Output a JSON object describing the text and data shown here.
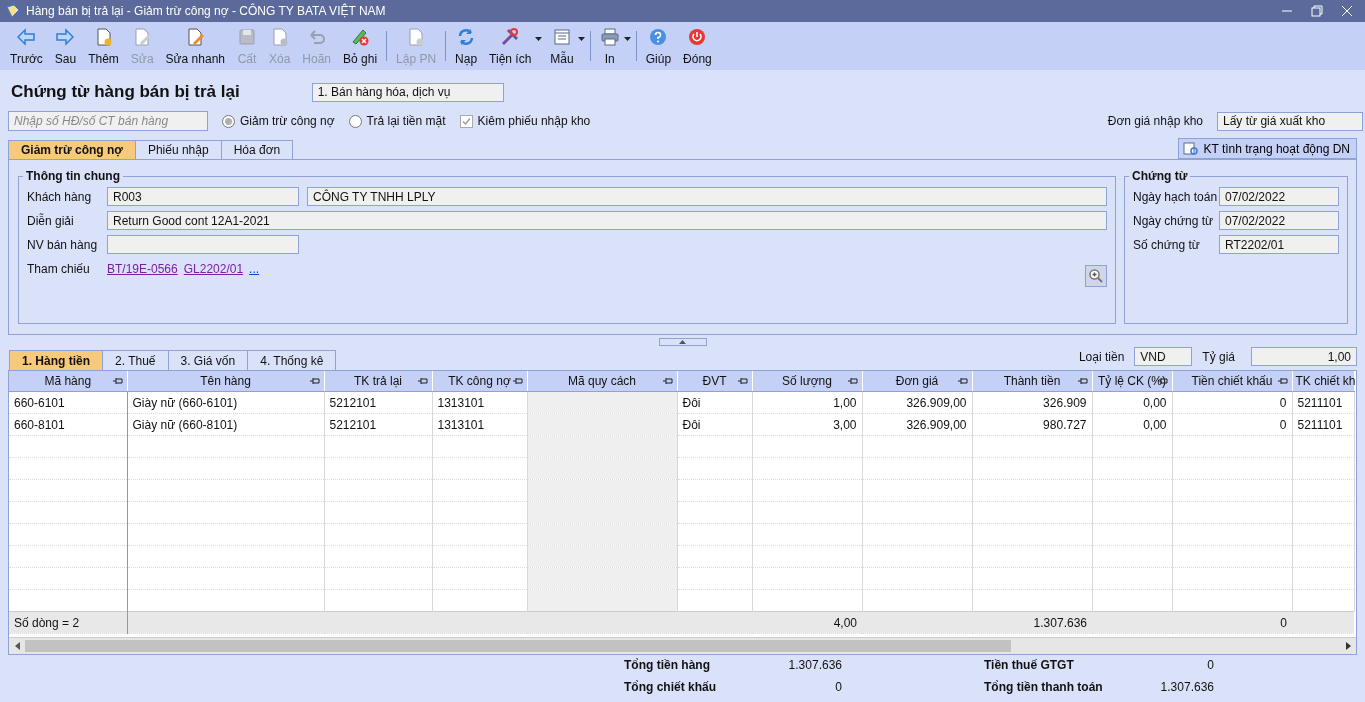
{
  "window": {
    "title": "Hàng bán bị trả lại - Giảm trừ công nợ - CÔNG TY BATA VIỆT NAM"
  },
  "toolbar": [
    [
      {
        "label": "Trước",
        "disabled": false,
        "dropdown": false
      },
      {
        "label": "Sau",
        "disabled": false,
        "dropdown": false
      },
      {
        "label": "Thêm",
        "disabled": false,
        "dropdown": false
      },
      {
        "label": "Sửa",
        "disabled": true,
        "dropdown": false
      },
      {
        "label": "Sửa nhanh",
        "disabled": false,
        "dropdown": false
      },
      {
        "label": "Cất",
        "disabled": true,
        "dropdown": false
      },
      {
        "label": "Xóa",
        "disabled": true,
        "dropdown": false
      },
      {
        "label": "Hoãn",
        "disabled": true,
        "dropdown": false
      },
      {
        "label": "Bỏ ghi",
        "disabled": false,
        "dropdown": false
      }
    ],
    [
      {
        "label": "Lập PN",
        "disabled": true,
        "dropdown": false
      }
    ],
    [
      {
        "label": "Nạp",
        "disabled": false,
        "dropdown": false
      },
      {
        "label": "Tiện ích",
        "disabled": false,
        "dropdown": true
      },
      {
        "label": "Mẫu",
        "disabled": false,
        "dropdown": true
      }
    ],
    [
      {
        "label": "In",
        "disabled": false,
        "dropdown": true
      }
    ],
    [
      {
        "label": "Giúp",
        "disabled": false,
        "dropdown": false
      },
      {
        "label": "Đóng",
        "disabled": false,
        "dropdown": false
      }
    ]
  ],
  "heading": "Chứng từ hàng bán bị trả lại",
  "voucher_type": "1. Bán hàng hóa, dịch vụ",
  "invoice_search": {
    "placeholder": "Nhập số HĐ/số CT bán hàng"
  },
  "options": [
    {
      "label": "Giảm trừ công nợ",
      "kind": "radio",
      "checked": true
    },
    {
      "label": "Trả lại tiền mặt",
      "kind": "radio",
      "checked": false
    },
    {
      "label": "Kiêm phiếu nhập kho",
      "kind": "checkbox",
      "checked": true
    }
  ],
  "unit_price_source": {
    "label": "Đơn giá nhập kho",
    "value": "Lấy từ giá xuất kho"
  },
  "tabs": [
    {
      "label": "Giảm trừ công nợ",
      "selected": true
    },
    {
      "label": "Phiếu nhập",
      "selected": false
    },
    {
      "label": "Hóa đơn",
      "selected": false
    }
  ],
  "check_button": "KT tình trạng hoạt động DN",
  "general": {
    "title": "Thông tin chung",
    "customer": {
      "label": "Khách hàng",
      "code": "R003",
      "name": "CÔNG TY TNHH LPLY"
    },
    "description": {
      "label": "Diễn giải",
      "value": "Return Good cont 12A1-2021"
    },
    "salesperson": {
      "label": "NV bán hàng"
    },
    "references": {
      "label": "Tham chiếu",
      "links": [
        "BT/19E-0566",
        "GL2202/01",
        "..."
      ]
    }
  },
  "voucher": {
    "title": "Chứng từ",
    "fields": [
      {
        "label": "Ngày hạch toán",
        "value": "07/02/2022"
      },
      {
        "label": "Ngày chứng từ",
        "value": "07/02/2022"
      },
      {
        "label": "Số chứng từ",
        "value": "RT2202/01"
      }
    ]
  },
  "detail_tabs": [
    {
      "label": "1. Hàng tiền",
      "selected": true
    },
    {
      "label": "2. Thuế",
      "selected": false
    },
    {
      "label": "3. Giá vốn",
      "selected": false
    },
    {
      "label": "4. Thống kê",
      "selected": false
    }
  ],
  "currency": {
    "label": "Loại tiền",
    "value": "VND"
  },
  "rate": {
    "label": "Tỷ giá",
    "value": "1,00"
  },
  "table": {
    "columns": [
      {
        "label": "Mã hàng",
        "kind": "text",
        "disabled": false
      },
      {
        "label": "Tên hàng",
        "kind": "text",
        "disabled": false
      },
      {
        "label": "TK trả lại",
        "kind": "text",
        "disabled": false
      },
      {
        "label": "TK công nợ",
        "kind": "text",
        "disabled": false
      },
      {
        "label": "Mã quy cách",
        "kind": "text",
        "disabled": true
      },
      {
        "label": "ĐVT",
        "kind": "text",
        "disabled": false
      },
      {
        "label": "Số lượng",
        "kind": "number",
        "disabled": false
      },
      {
        "label": "Đơn giá",
        "kind": "number",
        "disabled": false
      },
      {
        "label": "Thành tiền",
        "kind": "number",
        "disabled": false
      },
      {
        "label": "Tỷ lệ CK (%)",
        "kind": "number",
        "disabled": false
      },
      {
        "label": "Tiền chiết khấu",
        "kind": "number",
        "disabled": false
      },
      {
        "label": "TK chiết kh",
        "kind": "text",
        "disabled": false
      }
    ],
    "rows": [
      {
        "code": "660-6101",
        "name": "Giày nữ (660-6101)",
        "return_account": "5212101",
        "receivable_account": "1313101",
        "unit": "Đôi",
        "quantity": "1,00",
        "unit_price": "326.909,00",
        "amount": "326.909",
        "discount_rate": "0,00",
        "discount_amount": "0",
        "discount_account": "5211101"
      },
      {
        "code": "660-8101",
        "name": "Giày nữ (660-8101)",
        "return_account": "5212101",
        "receivable_account": "1313101",
        "unit": "Đôi",
        "quantity": "3,00",
        "unit_price": "326.909,00",
        "amount": "980.727",
        "discount_rate": "0,00",
        "discount_amount": "0",
        "discount_account": "5211101"
      }
    ],
    "footer": {
      "row_count": "Số dòng = 2",
      "quantity": "4,00",
      "amount": "1.307.636",
      "discount_amount": "0"
    }
  },
  "summary": [
    {
      "label": "Tổng tiền hàng",
      "value": "1.307.636"
    },
    {
      "label": "Tiền thuế GTGT",
      "value": "0"
    },
    {
      "label": "Tổng chiết khấu",
      "value": "0"
    },
    {
      "label": "Tổng tiền thanh toán",
      "value": "1.307.636"
    }
  ]
}
